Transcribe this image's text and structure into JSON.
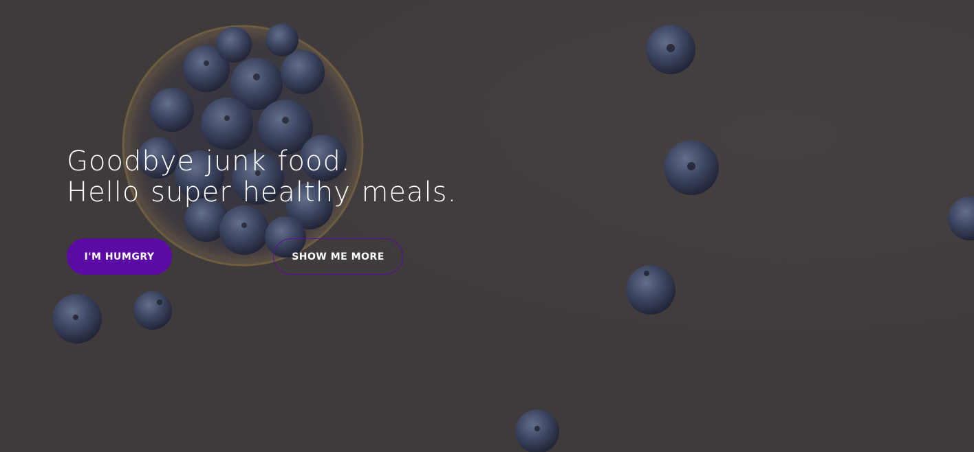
{
  "hero": {
    "heading_line_1": "Goodbye junk food.",
    "heading_line_2": "Hello super healthy meals.",
    "primary_button_label": "I'M HUMGRY",
    "secondary_button_label": "SHOW ME MORE"
  },
  "colors": {
    "accent": "#5b0aa3",
    "background": "#4e4849",
    "text": "#ffffff",
    "berry": "#3f4a6d"
  },
  "background_image": {
    "subject": "blueberries in a glass bowl on a stone surface"
  }
}
